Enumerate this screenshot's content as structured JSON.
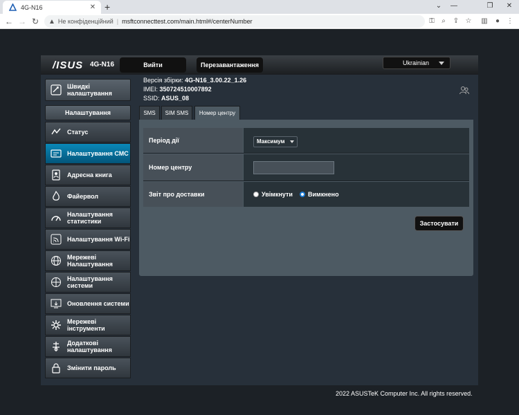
{
  "browser": {
    "tab_title": "4G-N16",
    "new_tab": "+",
    "security_label": "Не конфіденційний",
    "url": "msftconnecttest.com/main.html#/centerNumber"
  },
  "router": {
    "brand": "/ISUS",
    "model": "4G-N16",
    "logout_label": "Вийти",
    "reboot_label": "Перезавантаження",
    "language": "Ukrainian",
    "firmware_label": "Версія збірки:",
    "firmware_value": "4G-N16_3.00.22_1.26",
    "imei_label": "IMEI:",
    "imei_value": "350724510007892",
    "ssid_label": "SSID:",
    "ssid_value": "ASUS_08"
  },
  "sidebar": {
    "quick_label": "Швидкі налаштування",
    "section_label": "Налаштування",
    "items": [
      {
        "label": "Статус",
        "icon": "status-icon"
      },
      {
        "label": "Налаштування СМС",
        "icon": "sms-settings-icon"
      },
      {
        "label": "Адресна книга",
        "icon": "address-book-icon"
      },
      {
        "label": "Файервол",
        "icon": "firewall-icon"
      },
      {
        "label": "Налаштування статистики",
        "icon": "statistics-icon"
      },
      {
        "label": "Налаштування Wi-Fi",
        "icon": "wifi-icon"
      },
      {
        "label": "Мережеві Налаштування",
        "icon": "network-icon"
      },
      {
        "label": "Налаштування системи",
        "icon": "system-icon"
      },
      {
        "label": "Оновлення системи",
        "icon": "update-icon"
      },
      {
        "label": "Мережеві інструменти",
        "icon": "tools-icon"
      },
      {
        "label": "Додаткові налаштування",
        "icon": "advanced-icon"
      },
      {
        "label": "Змінити пароль",
        "icon": "lock-icon"
      }
    ]
  },
  "tabs": [
    "SMS",
    "SIM SMS",
    "Номер центру"
  ],
  "form": {
    "period_label": "Період дії",
    "period_value": "Максимум",
    "center_label": "Номер центру",
    "center_value": "",
    "report_label": "Звіт про доставки",
    "report_on": "Увімкнути",
    "report_off": "Вимкнено",
    "report_selected": "off",
    "apply_label": "Застосувати"
  },
  "footer": "2022 ASUSTeK Computer Inc. All rights reserved."
}
